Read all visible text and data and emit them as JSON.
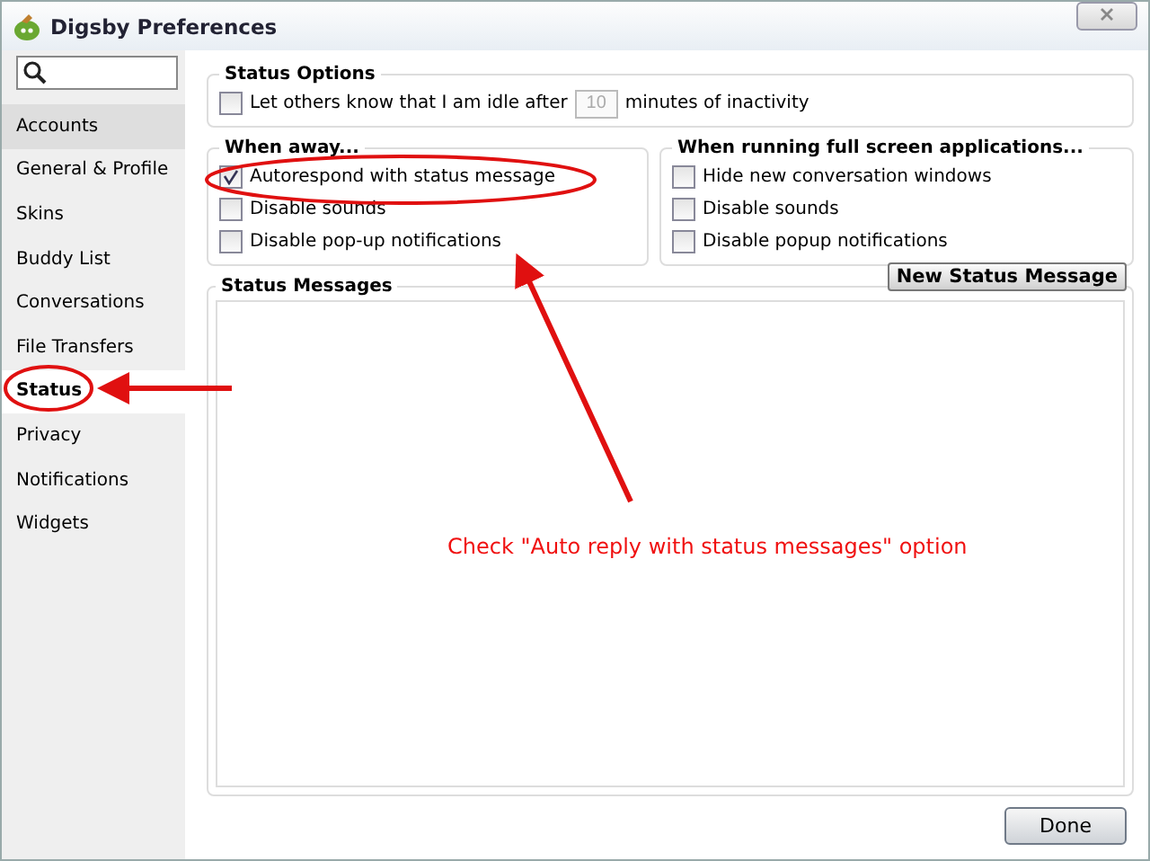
{
  "window": {
    "title": "Digsby Preferences"
  },
  "sidebar": {
    "items": [
      {
        "label": "Accounts",
        "selected": false,
        "hovered": true
      },
      {
        "label": "General & Profile",
        "selected": false,
        "hovered": false
      },
      {
        "label": "Skins",
        "selected": false,
        "hovered": false
      },
      {
        "label": "Buddy List",
        "selected": false,
        "hovered": false
      },
      {
        "label": "Conversations",
        "selected": false,
        "hovered": false
      },
      {
        "label": "File Transfers",
        "selected": false,
        "hovered": false
      },
      {
        "label": "Status",
        "selected": true,
        "hovered": false
      },
      {
        "label": "Privacy",
        "selected": false,
        "hovered": false
      },
      {
        "label": "Notifications",
        "selected": false,
        "hovered": false
      },
      {
        "label": "Widgets",
        "selected": false,
        "hovered": false
      }
    ]
  },
  "status_options": {
    "title": "Status Options",
    "idle": {
      "label": "Let others know that I am idle after",
      "checked": false,
      "minutes": "10",
      "minutes_disabled": true,
      "suffix": "minutes of inactivity"
    }
  },
  "when_away": {
    "title": "When away...",
    "options": [
      {
        "label": "Autorespond with status message",
        "checked": true
      },
      {
        "label": "Disable sounds",
        "checked": false
      },
      {
        "label": "Disable pop-up notifications",
        "checked": false
      }
    ]
  },
  "full_screen": {
    "title": "When running full screen applications...",
    "options": [
      {
        "label": "Hide new conversation windows",
        "checked": false
      },
      {
        "label": "Disable sounds",
        "checked": false
      },
      {
        "label": "Disable popup notifications",
        "checked": false
      }
    ]
  },
  "status_messages": {
    "title": "Status Messages",
    "new_button": "New Status Message"
  },
  "buttons": [
    "Done"
  ],
  "annotation": {
    "text": "Check \"Auto reply with status messages\" option"
  }
}
